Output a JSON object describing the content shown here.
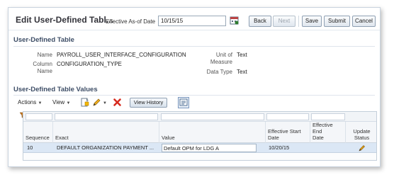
{
  "header": {
    "title": "Edit User-Defined Tabl...",
    "effective_label": "Effective As-of Date",
    "effective_date": "10/15/15",
    "buttons": {
      "back": "Back",
      "next": "Next",
      "save": "Save",
      "submit": "Submit",
      "cancel": "Cancel"
    }
  },
  "udt_section": {
    "heading": "User-Defined Table",
    "name_label": "Name",
    "name_value": "PAYROLL_USER_INTERFACE_CONFIGURATION",
    "column_name_label_1": "Column",
    "column_name_label_2": "Name",
    "column_name_value": "CONFIGURATION_TYPE",
    "uom_label_1": "Unit of",
    "uom_label_2": "Measure",
    "uom_value": "Text",
    "data_type_label": "Data Type",
    "data_type_value": "Text"
  },
  "values_section": {
    "heading": "User-Defined Table Values",
    "toolbar": {
      "actions": "Actions",
      "view": "View",
      "view_history": "View History"
    },
    "columns": {
      "sequence": "Sequence",
      "exact": "Exact",
      "value": "Value",
      "eff_start_1": "Effective Start",
      "eff_start_2": "Date",
      "eff_end_1": "Effective End",
      "eff_end_2": "Date",
      "update_1": "Update",
      "update_2": "Status"
    },
    "rows": [
      {
        "sequence": "10",
        "exact": "DEFAULT ORGANIZATION PAYMENT ...",
        "value": "Default OPM for LDG A",
        "eff_start": "10/20/15",
        "eff_end": ""
      }
    ]
  }
}
